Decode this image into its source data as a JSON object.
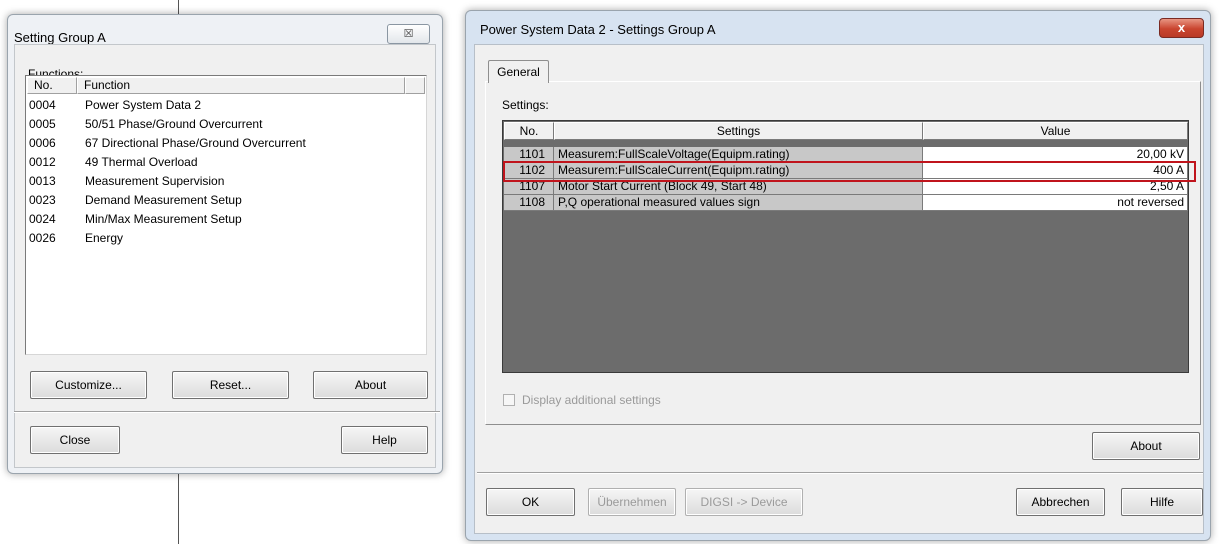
{
  "setting_group": {
    "title": "Setting Group A",
    "close_glyph": "☒",
    "functions_label": "Functions:",
    "columns": [
      "No.",
      "Function"
    ],
    "rows": [
      {
        "no": "0004",
        "function": "Power System Data 2"
      },
      {
        "no": "0005",
        "function": "50/51 Phase/Ground Overcurrent"
      },
      {
        "no": "0006",
        "function": "67 Directional Phase/Ground Overcurrent"
      },
      {
        "no": "0012",
        "function": "49 Thermal Overload"
      },
      {
        "no": "0013",
        "function": "Measurement Supervision"
      },
      {
        "no": "0023",
        "function": "Demand Measurement Setup"
      },
      {
        "no": "0024",
        "function": "Min/Max Measurement Setup"
      },
      {
        "no": "0026",
        "function": "Energy"
      }
    ],
    "buttons": {
      "customize": "Customize...",
      "reset": "Reset...",
      "about": "About",
      "close": "Close",
      "help": "Help"
    }
  },
  "psd": {
    "title": "Power System Data 2 - Settings Group A",
    "close_glyph": "x",
    "tab": "General",
    "settings_label": "Settings:",
    "columns": [
      "No.",
      "Settings",
      "Value"
    ],
    "rows": [
      {
        "no": "1101",
        "setting": "Measurem:FullScaleVoltage(Equipm.rating)",
        "value": "20,00 kV"
      },
      {
        "no": "1102",
        "setting": "Measurem:FullScaleCurrent(Equipm.rating)",
        "value": "400 A"
      },
      {
        "no": "1107",
        "setting": "Motor Start Current (Block 49, Start 48)",
        "value": "2,50 A"
      },
      {
        "no": "1108",
        "setting": "P,Q operational measured values sign",
        "value": "not reversed"
      }
    ],
    "display_additional": "Display additional settings",
    "buttons": {
      "about": "About",
      "ok": "OK",
      "apply": "Übernehmen",
      "digsi": "DIGSI -> Device",
      "cancel": "Abbrechen",
      "help": "Hilfe"
    }
  }
}
